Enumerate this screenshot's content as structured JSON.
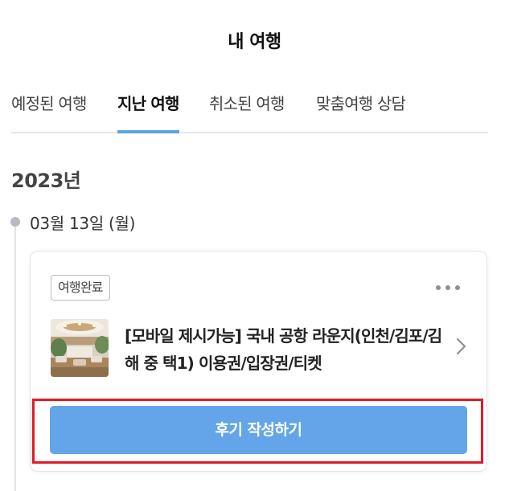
{
  "header": {
    "title": "내 여행"
  },
  "tabs": [
    {
      "label": "예정된 여행",
      "active": false
    },
    {
      "label": "지난 여행",
      "active": true
    },
    {
      "label": "취소된 여행",
      "active": false
    },
    {
      "label": "맞춤여행 상담",
      "active": false
    }
  ],
  "timeline": {
    "year": "2023년",
    "date": "03월 13일 (월)"
  },
  "booking": {
    "status_badge": "여행완료",
    "product_title": "[모바일 제시가능] 국내 공항 라운지(인천/김포/김해 중 택1) 이용권/입장권/티켓",
    "more_icon": "more-horizontal-icon",
    "chevron_icon": "chevron-right-icon",
    "review_button_label": "후기 작성하기"
  },
  "colors": {
    "accent": "#5ea2e6",
    "button": "#63a5e8",
    "highlight": "#e21a23"
  }
}
